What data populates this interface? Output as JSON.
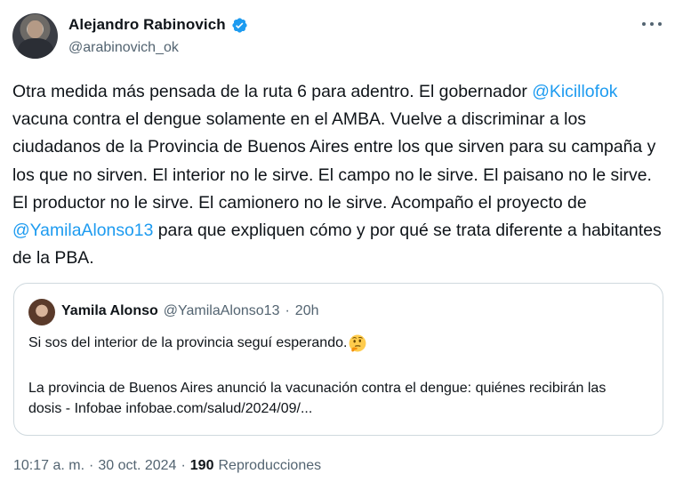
{
  "author": {
    "name": "Alejandro Rabinovich",
    "handle": "@arabinovich_ok",
    "verified_icon": "verified-badge-icon",
    "verified_color": "#1d9bf0"
  },
  "more_icon": "ellipsis-icon",
  "tweet": {
    "text_1": "Otra medida más pensada de la ruta 6 para adentro. El gobernador",
    "mention_1": "@Kicillofok",
    "text_2": "vacuna contra el dengue solamente en el AMBA. Vuelve a discriminar a los ciudadanos de la Provincia de Buenos Aires entre los que sirven para su campaña y los que no sirven. El interior no le sirve. El campo no le sirve. El paisano no le sirve. El productor no le sirve. El camionero no le sirve. Acompaño el proyecto de",
    "mention_2": "@YamilaAlonso13",
    "text_3": "para que expliquen cómo y por qué se trata diferente a habitantes de la PBA."
  },
  "quote": {
    "name": "Yamila Alonso",
    "handle": "@YamilaAlonso13",
    "separator": "·",
    "time": "20h",
    "line_1": "Si sos del interior de la provincia seguí esperando.",
    "emoji": "thinking-face-icon",
    "paragraph": "La provincia de Buenos Aires anunció la vacunación contra el dengue: quiénes recibirán las dosis - Infobae infobae.com/salud/2024/09/..."
  },
  "footer": {
    "time": "10:17 a. m.",
    "separator": "·",
    "date": "30 oct. 2024",
    "views_count": "190",
    "views_label": "Reproducciones"
  },
  "colors": {
    "link": "#1d9bf0",
    "secondary_text": "#536471",
    "primary_text": "#0f1419",
    "border": "#cfd9de"
  }
}
